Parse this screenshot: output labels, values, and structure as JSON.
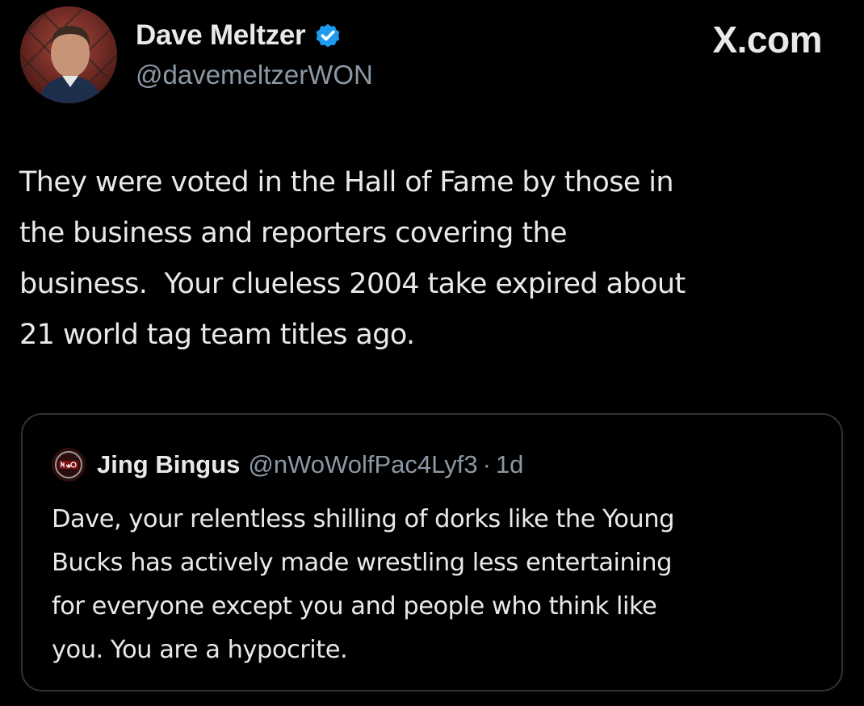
{
  "tweet": {
    "author": {
      "name": "Dave Meltzer",
      "handle": "@davemeltzerWON",
      "verified": true,
      "avatar_icon": "user-avatar-photo"
    },
    "site_label": "X.com",
    "text": "They were voted in the Hall of Fame by those in\nthe business and reporters covering the\nbusiness.  Your clueless 2004 take expired about\n21 world tag team titles ago."
  },
  "quoted_tweet": {
    "author": {
      "name": "Jing Bingus",
      "handle": "@nWoWolfPac4Lyf3",
      "avatar_icon": "nwo-logo-avatar"
    },
    "separator": "·",
    "time": "1d",
    "text": "Dave, your relentless shilling of dorks like the Young\nBucks has actively made wrestling less entertaining\nfor everyone except you and people who think like\nyou. You are a hypocrite."
  },
  "colors": {
    "background": "#000000",
    "text_primary": "#e7e9ea",
    "text_secondary": "#8b98a5",
    "verified_badge": "#1d9bf0",
    "card_border": "#2f3336"
  }
}
